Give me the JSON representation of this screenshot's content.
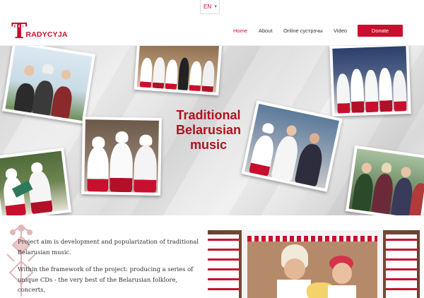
{
  "language": {
    "current": "EN"
  },
  "header": {
    "logo_initial": "T",
    "logo_rest": "RADYCYJA",
    "nav": [
      "Home",
      "About",
      "Online сустрэчы",
      "Video"
    ],
    "donate_label": "Donate"
  },
  "hero": {
    "title_line1": "Traditional",
    "title_line2": "Belarusian",
    "title_line3": "music"
  },
  "content": {
    "paragraph1": "Project aim is development and popularization of traditional Belarusian music.",
    "paragraph2": "Within the framework of the project: producing a series of unique CDs - the very best of the Belarusian folklore, concerts,"
  },
  "slider": {
    "prev_label": "‹"
  },
  "colors": {
    "accent": "#c8102e",
    "hero_title": "#b0121e"
  }
}
